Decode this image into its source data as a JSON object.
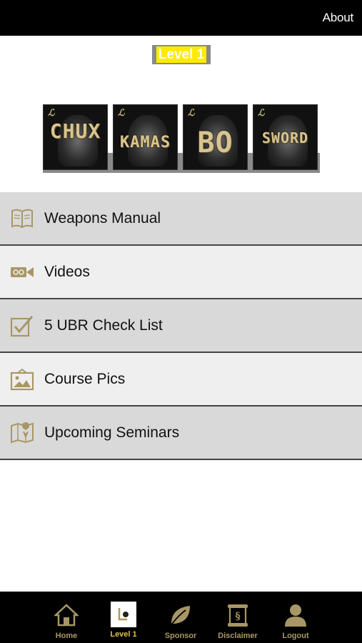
{
  "header": {
    "about_label": "About"
  },
  "level_title": "Level 1",
  "banner": {
    "tiles": [
      {
        "word": "CHUX",
        "icon": "nunchuck-figure-image"
      },
      {
        "word": "KAMAS",
        "icon": "kama-figure-image"
      },
      {
        "word": "BO",
        "icon": "bo-staff-figure-image"
      },
      {
        "word": "SWORD",
        "icon": "sword-figure-image"
      }
    ]
  },
  "menu": {
    "items": [
      {
        "label": "Weapons Manual",
        "icon": "open-book-icon"
      },
      {
        "label": "Videos",
        "icon": "video-camera-icon"
      },
      {
        "label": "5 UBR Check List",
        "icon": "checklist-icon"
      },
      {
        "label": "Course Pics",
        "icon": "picture-icon"
      },
      {
        "label": "Upcoming Seminars",
        "icon": "map-pin-icon"
      }
    ]
  },
  "tabbar": {
    "tabs": [
      {
        "label": "Home",
        "icon": "home-icon"
      },
      {
        "label": "Level 1",
        "icon": "level-logo-icon",
        "active": true
      },
      {
        "label": "Sponsor",
        "icon": "leaf-icon"
      },
      {
        "label": "Disclaimer",
        "icon": "legal-document-icon"
      },
      {
        "label": "Logout",
        "icon": "user-icon"
      }
    ]
  },
  "colors": {
    "accent_gold": "#a89766",
    "active_gold": "#e2c14a",
    "highlight_yellow": "#ffeb00"
  }
}
